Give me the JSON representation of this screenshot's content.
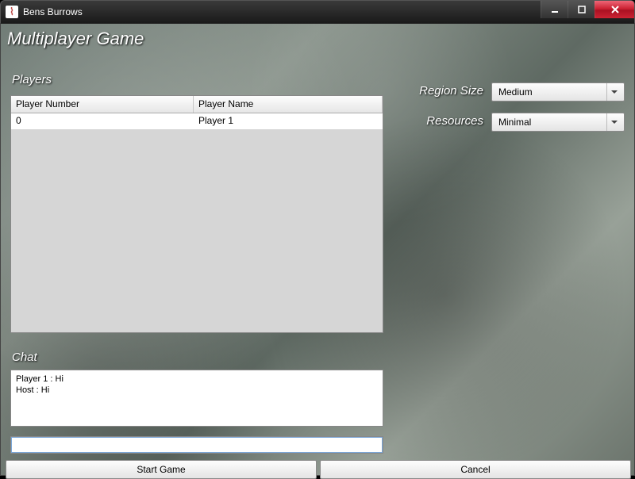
{
  "window": {
    "title": "Bens Burrows"
  },
  "header": "Multiplayer Game",
  "players": {
    "label": "Players",
    "columns": {
      "number": "Player Number",
      "name": "Player Name"
    },
    "rows": [
      {
        "number": "0",
        "name": "Player 1"
      }
    ]
  },
  "chat": {
    "label": "Chat",
    "messages": [
      "Player 1 : Hi",
      "Host : Hi"
    ],
    "input_value": ""
  },
  "settings": {
    "region": {
      "label": "Region Size",
      "value": "Medium"
    },
    "resources": {
      "label": "Resources",
      "value": "Minimal"
    }
  },
  "buttons": {
    "start": "Start Game",
    "cancel": "Cancel"
  }
}
